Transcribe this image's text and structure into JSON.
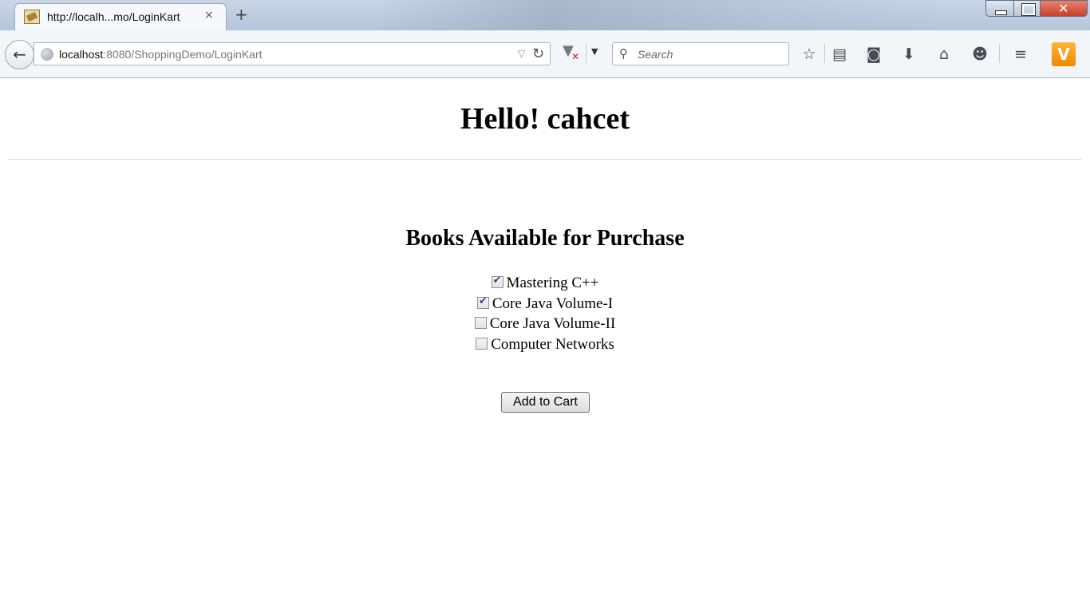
{
  "browser": {
    "tab_title": "http://localh...mo/LoginKart",
    "tab_close_icon": "×",
    "new_tab_icon": "+",
    "url_host": "localhost",
    "url_rest": ":8080/ShoppingDemo/LoginKart",
    "search_placeholder": "Search",
    "window_close_icon": "✕"
  },
  "page": {
    "greeting": "Hello! cahcet",
    "section_title": "Books Available for Purchase",
    "books": [
      {
        "label": "Mastering C++",
        "checked": true
      },
      {
        "label": "Core Java Volume-I",
        "checked": true
      },
      {
        "label": "Core Java Volume-II",
        "checked": false
      },
      {
        "label": "Computer Networks",
        "checked": false
      }
    ],
    "add_button_label": "Add to Cart"
  }
}
